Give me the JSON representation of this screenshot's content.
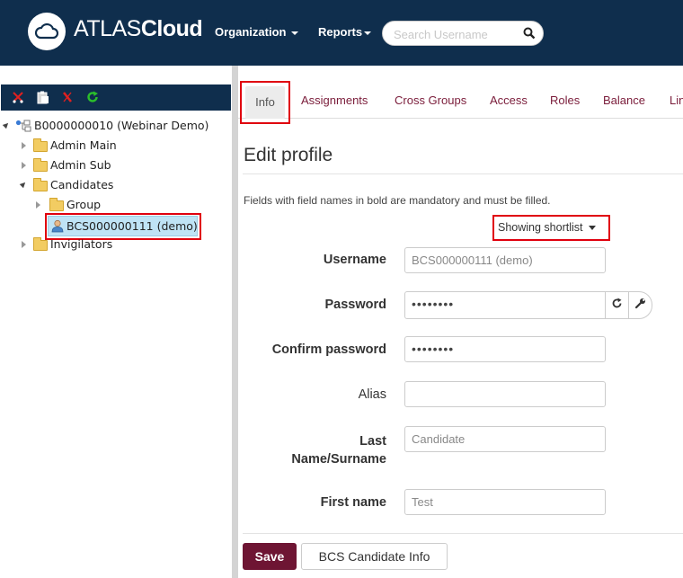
{
  "header": {
    "brand_light": "ATLAS",
    "brand_bold": "Cloud",
    "nav": [
      {
        "label": "Organization"
      },
      {
        "label": "Reports"
      }
    ],
    "search": {
      "placeholder": "Search Username",
      "value": ""
    }
  },
  "toolbar": {
    "icons": [
      "cut-icon",
      "paste-icon",
      "delete-icon",
      "refresh-icon"
    ]
  },
  "tree": {
    "root": "B0000000010 (Webinar Demo)",
    "items": [
      {
        "label": "Admin Main"
      },
      {
        "label": "Admin Sub"
      },
      {
        "label": "Candidates"
      },
      {
        "label": "Group"
      },
      {
        "label": "BCS000000111 (demo)"
      },
      {
        "label": "Invigilators"
      }
    ]
  },
  "tabs": [
    {
      "label": "Info"
    },
    {
      "label": "Assignments"
    },
    {
      "label": "Cross Groups"
    },
    {
      "label": "Access"
    },
    {
      "label": "Roles"
    },
    {
      "label": "Balance"
    },
    {
      "label": "Lin"
    }
  ],
  "main": {
    "title": "Edit profile",
    "hint": "Fields with field names in bold are mandatory and must be filled.",
    "shortlist_label": "Showing shortlist"
  },
  "form": {
    "username": {
      "label": "Username",
      "value": "BCS000000111 (demo)"
    },
    "password": {
      "label": "Password",
      "value": "••••••••"
    },
    "confirm_password": {
      "label": "Confirm password",
      "value": "••••••••"
    },
    "alias": {
      "label": "Alias",
      "value": ""
    },
    "last_name": {
      "label_line1": "Last",
      "label_line2": "Name/Surname",
      "placeholder": "Candidate"
    },
    "first_name": {
      "label": "First name",
      "placeholder": "Test"
    }
  },
  "buttons": {
    "save": "Save",
    "candidate_info": "BCS Candidate Info"
  },
  "colors": {
    "header_bg": "#0f2e4d",
    "accent": "#6e1533",
    "highlight": "#e0000e"
  }
}
